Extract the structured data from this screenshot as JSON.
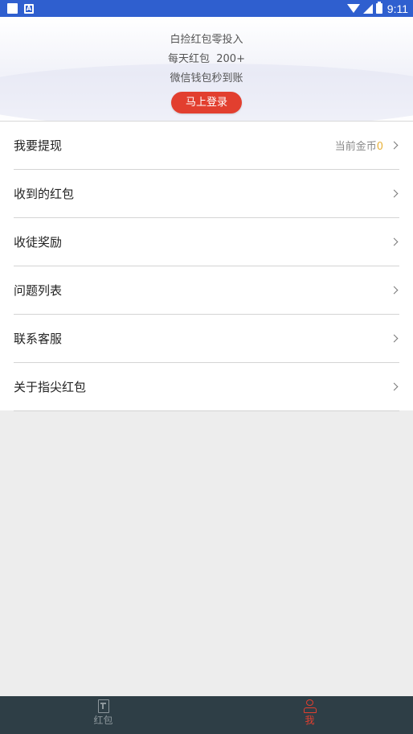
{
  "status_bar": {
    "time": "9:11",
    "icons": [
      "notification-square-icon",
      "app-a-icon",
      "wifi-icon",
      "signal-icon",
      "battery-icon"
    ],
    "background_color": "#2f5fcf"
  },
  "header": {
    "lines": [
      "白捡红包零投入",
      "每天红包  200+",
      "微信钱包秒到账"
    ],
    "login_button": "马上登录",
    "accent_color": "#e23f2f"
  },
  "menu": {
    "items": [
      {
        "label": "我要提现",
        "extra_label": "当前金币",
        "extra_value": "0"
      },
      {
        "label": "收到的红包"
      },
      {
        "label": "收徒奖励"
      },
      {
        "label": "问题列表"
      },
      {
        "label": "联系客服"
      },
      {
        "label": "关于指尖红包"
      }
    ]
  },
  "bottom_nav": {
    "items": [
      {
        "label": "红包",
        "icon": "redpacket-icon",
        "active": false
      },
      {
        "label": "我",
        "icon": "person-icon",
        "active": true
      }
    ],
    "background_color": "#2e3e46"
  }
}
